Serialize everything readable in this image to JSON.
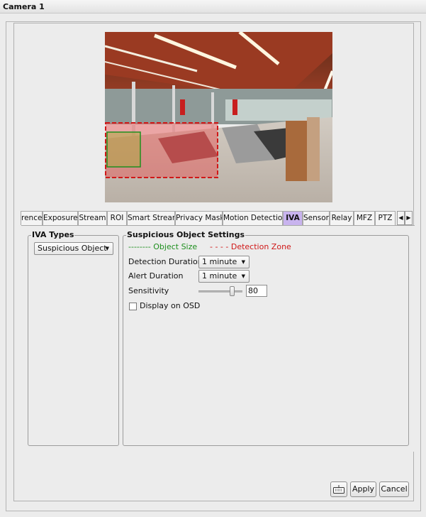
{
  "window": {
    "title": "Camera 1"
  },
  "tabs": [
    {
      "label": "rence",
      "active": false
    },
    {
      "label": "Exposure",
      "active": false
    },
    {
      "label": "Stream",
      "active": false
    },
    {
      "label": "ROI",
      "active": false
    },
    {
      "label": "Smart Stream",
      "active": false
    },
    {
      "label": "Privacy Mask",
      "active": false
    },
    {
      "label": "Motion Detection",
      "active": false
    },
    {
      "label": "IVA",
      "active": true
    },
    {
      "label": "Sensor",
      "active": false
    },
    {
      "label": "Relay",
      "active": false
    },
    {
      "label": "MFZ",
      "active": false
    },
    {
      "label": "PTZ",
      "active": false
    }
  ],
  "iva_types": {
    "title": "IVA Types",
    "selected": "Suspicious Object"
  },
  "settings": {
    "title": "Suspicious Object Settings",
    "legend_object_size": "-------- Object Size",
    "legend_detection_zone": "- - - - Detection Zone",
    "detection_duration_label": "Detection Duration",
    "detection_duration_value": "1 minute",
    "alert_duration_label": "Alert Duration",
    "alert_duration_value": "1 minute",
    "sensitivity_label": "Sensitivity",
    "sensitivity_value": "80",
    "sensitivity_level_percent": 80,
    "display_osd_label": "Display on OSD",
    "display_osd_checked": false
  },
  "buttons": {
    "apply": "Apply",
    "cancel": "Cancel"
  },
  "colors": {
    "object_size": "#1e8f1e",
    "detection_zone": "#d01818",
    "active_tab": "#c8b3ee"
  }
}
